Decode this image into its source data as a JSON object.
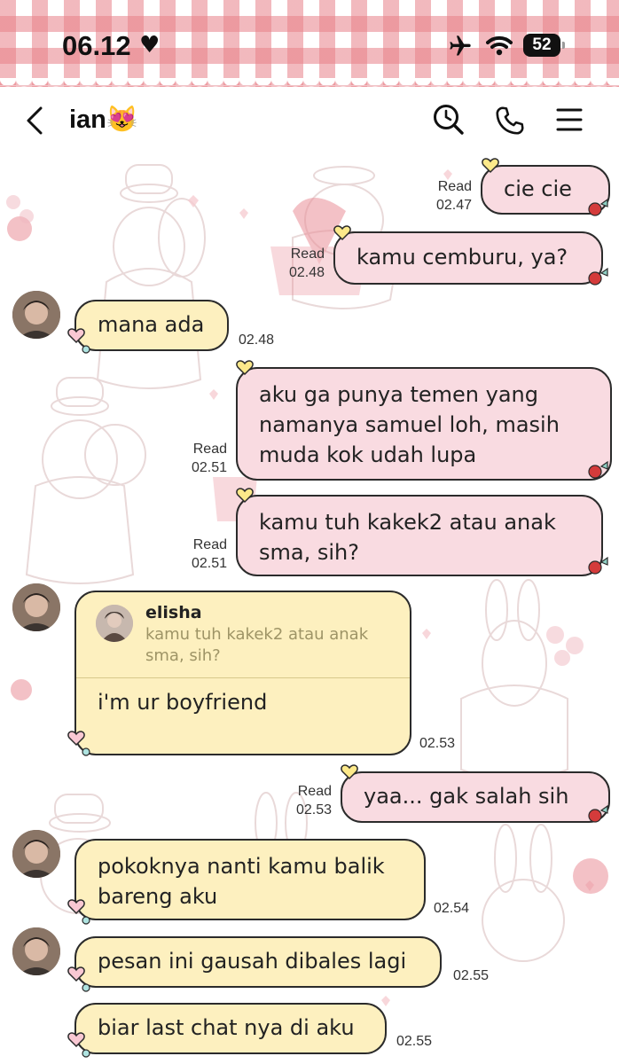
{
  "status": {
    "time": "06.12",
    "battery": "52"
  },
  "header": {
    "title": "ian😻"
  },
  "messages": [
    {
      "dir": "out",
      "text": "cie cie",
      "read": "Read",
      "time": "02.47"
    },
    {
      "dir": "out",
      "text": "kamu cemburu, ya?",
      "read": "Read",
      "time": "02.48"
    },
    {
      "dir": "in",
      "text": "mana ada",
      "time": "02.48"
    },
    {
      "dir": "out",
      "text": "aku ga punya temen yang\nnamanya samuel loh, masih\nmuda kok udah lupa",
      "read": "Read",
      "time": "02.51"
    },
    {
      "dir": "out",
      "text": "kamu tuh kakek2 atau anak\nsma, sih?",
      "read": "Read",
      "time": "02.51"
    },
    {
      "dir": "in",
      "reply_name": "elisha",
      "reply_quote": "kamu tuh kakek2 atau anak\nsma, sih?",
      "text": "i'm ur boyfriend",
      "time": "02.53"
    },
    {
      "dir": "out",
      "text": "yaa... gak salah sih",
      "read": "Read",
      "time": "02.53"
    },
    {
      "dir": "in",
      "text": "pokoknya nanti kamu balik\nbareng aku",
      "time": "02.54"
    },
    {
      "dir": "in",
      "text": "pesan ini gausah dibales lagi",
      "time": "02.55"
    },
    {
      "dir": "in",
      "text": "biar last chat nya di aku",
      "time": "02.55"
    }
  ]
}
